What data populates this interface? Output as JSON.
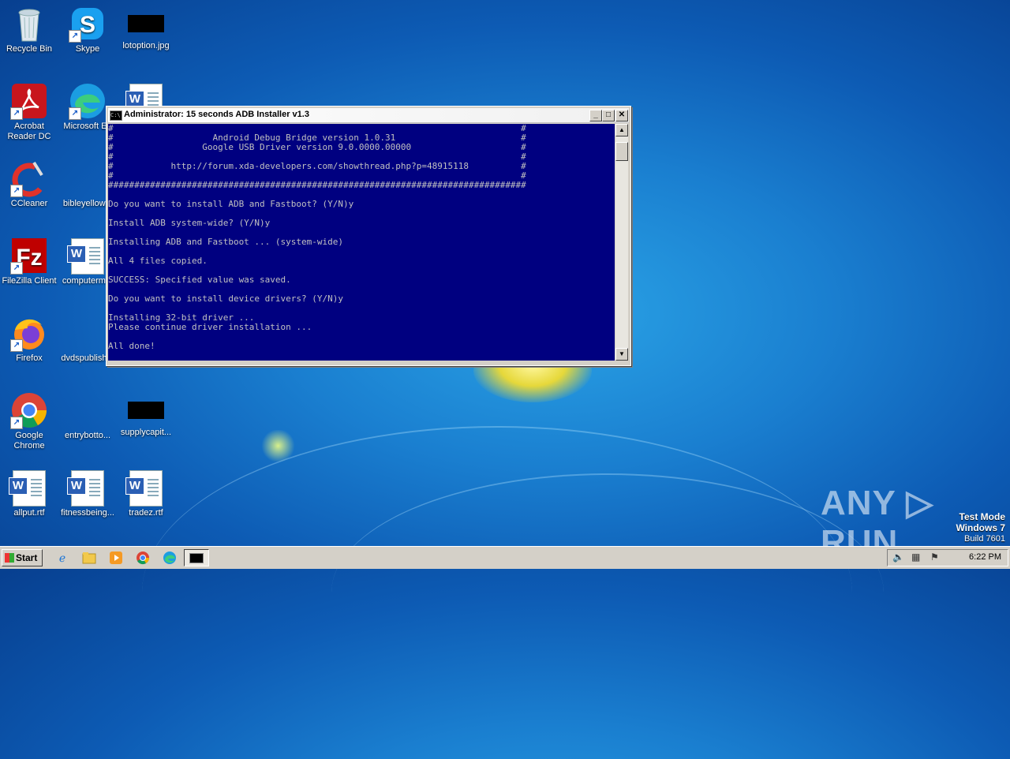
{
  "desktop": {
    "icons": [
      {
        "label": "Recycle Bin",
        "icon": "recycle-bin-icon"
      },
      {
        "label": "Skype",
        "icon": "skype-icon"
      },
      {
        "label": "lotoption.jpg",
        "icon": "image-file-icon"
      },
      {
        "label": "Acrobat Reader DC",
        "icon": "acrobat-icon"
      },
      {
        "label": "Microsoft Ed",
        "icon": "edge-icon"
      },
      {
        "label": "CCleaner",
        "icon": "ccleaner-icon"
      },
      {
        "label": "bibleyellow...",
        "icon": "file-icon"
      },
      {
        "label": "FileZilla Client",
        "icon": "filezilla-icon"
      },
      {
        "label": "computerm...",
        "icon": "word-doc-icon"
      },
      {
        "label": "Firefox",
        "icon": "firefox-icon"
      },
      {
        "label": "dvdspublish...",
        "icon": "file-icon"
      },
      {
        "label": "Google Chrome",
        "icon": "chrome-icon"
      },
      {
        "label": "entrybotto...",
        "icon": "file-icon"
      },
      {
        "label": "supplycapit...",
        "icon": "image-file-icon"
      },
      {
        "label": "allput.rtf",
        "icon": "word-doc-icon"
      },
      {
        "label": "fitnessbeing...",
        "icon": "word-doc-icon"
      },
      {
        "label": "tradez.rtf",
        "icon": "word-doc-icon"
      }
    ]
  },
  "window": {
    "title": "Administrator:  15 seconds ADB Installer v1.3",
    "min": "_",
    "max": "□",
    "close": "✕",
    "console_lines": [
      "#                                                                              #",
      "#                   Android Debug Bridge version 1.0.31                        #",
      "#                 Google USB Driver version 9.0.0000.00000                     #",
      "#                                                                              #",
      "#           http://forum.xda-developers.com/showthread.php?p=48915118          #",
      "#                                                                              #",
      "################################################################################",
      "",
      "Do you want to install ADB and Fastboot? (Y/N)y",
      "",
      "Install ADB system-wide? (Y/N)y",
      "",
      "Installing ADB and Fastboot ... (system-wide)",
      "",
      "All 4 files copied.",
      "",
      "SUCCESS: Specified value was saved.",
      "",
      "Do you want to install device drivers? (Y/N)y",
      "",
      "Installing 32-bit driver ...",
      "Please continue driver installation ...",
      "",
      "All done!"
    ]
  },
  "watermark": {
    "brand": "ANY ▷ RUN",
    "line1": "Test Mode",
    "line2": "Windows 7",
    "line3": "Build 7601"
  },
  "taskbar": {
    "start_label": "Start",
    "quicklaunch": [
      "ie-icon",
      "explorer-icon",
      "media-player-icon",
      "chrome-icon",
      "edge-icon"
    ],
    "tray_icons": [
      "volume-icon",
      "network-icon",
      "flag-icon"
    ],
    "clock": "6:22 PM"
  }
}
